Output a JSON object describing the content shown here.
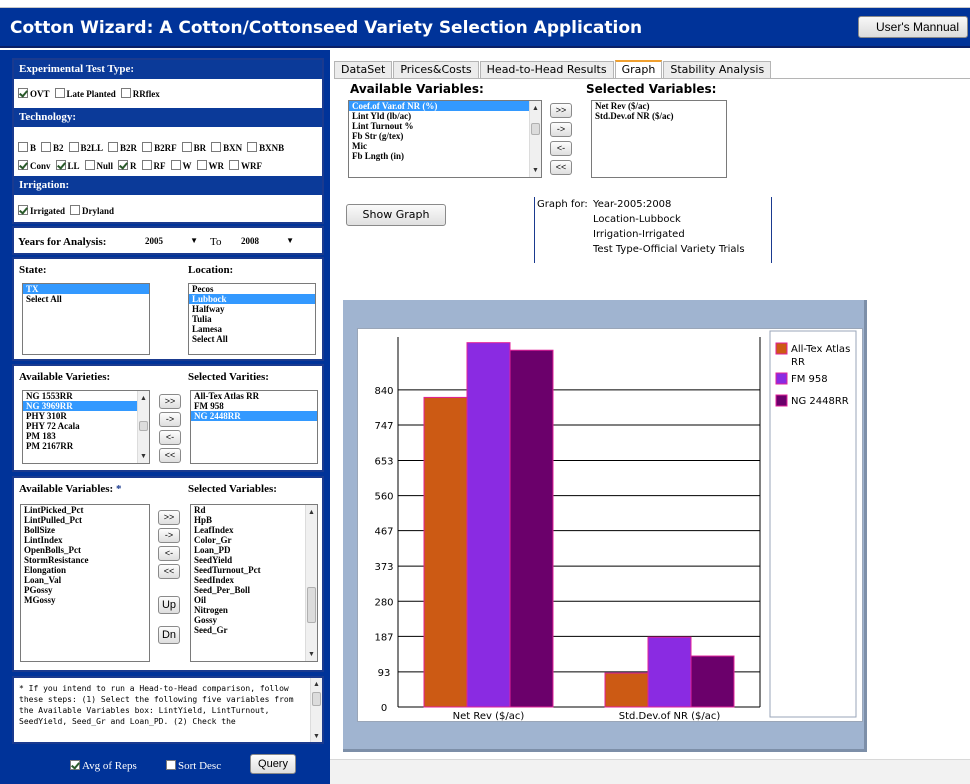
{
  "app": {
    "title": "Cotton Wizard:  A Cotton/Cottonseed Variety Selection Application",
    "manual_button": "User's Mannual"
  },
  "left": {
    "test_type": {
      "heading": "Experimental Test Type:",
      "options": [
        {
          "label": "OVT",
          "checked": true
        },
        {
          "label": "Late Planted",
          "checked": false
        },
        {
          "label": "RRflex",
          "checked": false
        }
      ]
    },
    "technology": {
      "heading": "Technology:",
      "row1": [
        {
          "label": "B",
          "checked": false
        },
        {
          "label": "B2",
          "checked": false
        },
        {
          "label": "B2LL",
          "checked": false
        },
        {
          "label": "B2R",
          "checked": false
        },
        {
          "label": "B2RF",
          "checked": false
        },
        {
          "label": "BR",
          "checked": false
        },
        {
          "label": "BXN",
          "checked": false
        },
        {
          "label": "BXNB",
          "checked": false
        }
      ],
      "row2": [
        {
          "label": "Conv",
          "checked": true
        },
        {
          "label": "LL",
          "checked": true
        },
        {
          "label": "Null",
          "checked": false
        },
        {
          "label": "R",
          "checked": true
        },
        {
          "label": "RF",
          "checked": false
        },
        {
          "label": "W",
          "checked": false
        },
        {
          "label": "WR",
          "checked": false
        },
        {
          "label": "WRF",
          "checked": false
        }
      ]
    },
    "irrigation": {
      "heading": "Irrigation:",
      "options": [
        {
          "label": "Irrigated",
          "checked": true
        },
        {
          "label": "Dryland",
          "checked": false
        }
      ]
    },
    "years": {
      "label": "Years for Analysis:",
      "from": "2005",
      "to_label": "To",
      "to": "2008"
    },
    "state": {
      "label": "State:",
      "items": [
        "TX",
        "Select All"
      ],
      "selected": "TX"
    },
    "location": {
      "label": "Location:",
      "items": [
        "Pecos",
        "Lubbock",
        "Halfway",
        "Tulia",
        "Lamesa",
        "Select All"
      ],
      "selected": "Lubbock"
    },
    "varieties": {
      "available_label": "Available Varieties:",
      "selected_label": "Selected Varities:",
      "available": [
        "NG 1553RR",
        "NG 3969RR",
        "PHY 310R",
        "PHY 72 Acala",
        "PM 183",
        "PM 2167RR"
      ],
      "available_highlight": "NG 3969RR",
      "selected": [
        "All-Tex Atlas RR",
        "FM 958",
        "NG 2448RR"
      ],
      "selected_highlight": "NG 2448RR"
    },
    "move_buttons": {
      "all_right": ">>",
      "right": "->",
      "left": "<-",
      "all_left": "<<",
      "up": "Up",
      "down": "Dn"
    },
    "variables": {
      "available_label": "Available Variables:",
      "asterisk": "*",
      "selected_label": "Selected Variables:",
      "available": [
        "LintPicked_Pct",
        "LintPulled_Pct",
        "BollSize",
        "LintIndex",
        "OpenBolls_Pct",
        "StormResistance",
        "Elongation",
        "Loan_Val",
        "PGossy",
        "MGossy"
      ],
      "selected": [
        "Rd",
        "HpB",
        "LeafIndex",
        "Color_Gr",
        "Loan_PD",
        "SeedYield",
        "SeedTurnout_Pct",
        "SeedIndex",
        "Seed_Per_Boll",
        "Oil",
        "Nitrogen",
        "Gossy",
        "Seed_Gr"
      ]
    },
    "note": "* If you intend to run a Head-to-Head comparison, follow these steps: (1) Select the following five variables from the Available Variables box: LintYield, LintTurnout, SeedYield, Seed_Gr and Loan_PD. (2) Check the",
    "avg_of_reps": {
      "label": "Avg of Reps",
      "checked": true
    },
    "sort_desc": {
      "label": "Sort Desc",
      "checked": false
    },
    "query_button": "Query"
  },
  "right": {
    "tabs": [
      {
        "label": "DataSet",
        "active": false
      },
      {
        "label": "Prices&Costs",
        "active": false
      },
      {
        "label": "Head-to-Head Results",
        "active": false
      },
      {
        "label": "Graph",
        "active": true
      },
      {
        "label": "Stability Analysis",
        "active": false
      }
    ],
    "available_variables_label": "Available Variables:",
    "available_variables": [
      "Coef.of Var.of NR (%)",
      "Lint Yld (lb/ac)",
      "Lint Turnout %",
      "Fb Str (g/tex)",
      "Mic",
      "Fb Lngth (in)"
    ],
    "available_highlight": "Coef.of Var.of NR (%)",
    "selected_variables_label": "Selected Variables:",
    "selected_variables": [
      "Net Rev ($/ac)",
      "Std.Dev.of NR ($/ac)"
    ],
    "show_graph_button": "Show Graph",
    "graph_for": {
      "prefix": "Graph for:",
      "lines": [
        "Year-2005:2008",
        "Location-Lubbock",
        "Irrigation-Irrigated",
        "Test Type-Official Variety Trials"
      ]
    }
  },
  "chart_data": {
    "type": "bar",
    "categories": [
      "Net Rev ($/ac)",
      "Std.Dev.of NR ($/ac)"
    ],
    "series": [
      {
        "name": "All-Tex Atlas RR",
        "color": "#cc5a14",
        "values": [
          820,
          90
        ]
      },
      {
        "name": "FM 958",
        "color": "#8a2be2",
        "values": [
          965,
          185
        ]
      },
      {
        "name": "NG 2448RR",
        "color": "#6b006b",
        "values": [
          945,
          135
        ]
      }
    ],
    "yticks": [
      "0",
      "93",
      "187",
      "280",
      "373",
      "467",
      "560",
      "653",
      "747",
      "840"
    ],
    "ylim": [
      0,
      980
    ],
    "legend_position": "right",
    "grid": true
  }
}
